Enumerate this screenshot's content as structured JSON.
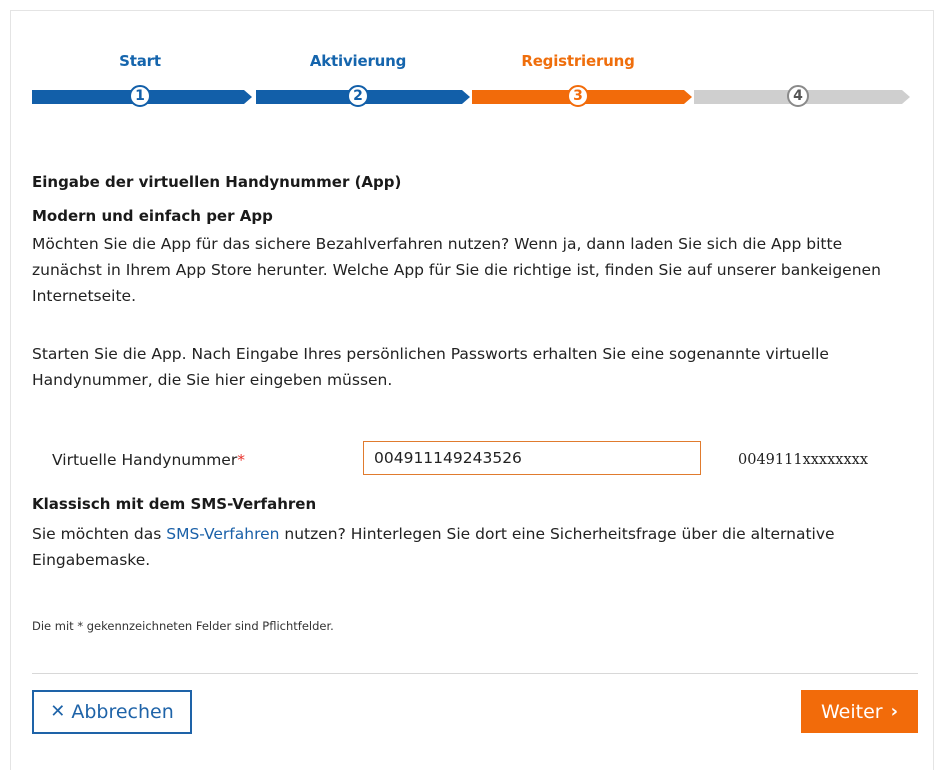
{
  "stepper": {
    "steps": [
      {
        "label": "Start",
        "number": "1",
        "state": "done"
      },
      {
        "label": "Aktivierung",
        "number": "2",
        "state": "done"
      },
      {
        "label": "Registrierung",
        "number": "3",
        "state": "active"
      },
      {
        "label": "",
        "number": "4",
        "state": "pending"
      }
    ],
    "colors": {
      "done": "#125fa9",
      "active": "#f26b0a",
      "pending": "#cfcfcf"
    }
  },
  "main": {
    "title": "Eingabe der virtuellen Handynummer (App)",
    "app_section": {
      "heading": "Modern und einfach per App",
      "paragraph1": "Möchten Sie die App für das sichere Bezahlverfahren nutzen? Wenn ja, dann laden Sie sich die App bitte zunächst in Ihrem App Store herunter. Welche App für Sie die richtige ist, finden Sie auf unserer bankeigenen Internetseite.",
      "paragraph2": "Starten Sie die App. Nach Eingabe Ihres persönlichen Passworts erhalten Sie eine sogenannte virtuelle Handynummer, die Sie hier eingeben müssen."
    },
    "field": {
      "label": "Virtuelle Handynummer",
      "required_mark": "*",
      "value": "004911149243526",
      "format_hint": "0049111xxxxxxxx"
    },
    "sms_section": {
      "heading": "Klassisch mit dem SMS-Verfahren",
      "text_before": "Sie möchten das ",
      "link_text": "SMS-Verfahren",
      "text_after": " nutzen? Hinterlegen Sie dort eine Sicherheitsfrage über die alternative Eingabemaske."
    },
    "required_note": "Die mit * gekennzeichneten Felder sind Pflichtfelder."
  },
  "footer": {
    "cancel_label": "Abbrechen",
    "cancel_icon": "close-icon",
    "next_label": "Weiter",
    "next_icon": "chevron-right-icon"
  }
}
